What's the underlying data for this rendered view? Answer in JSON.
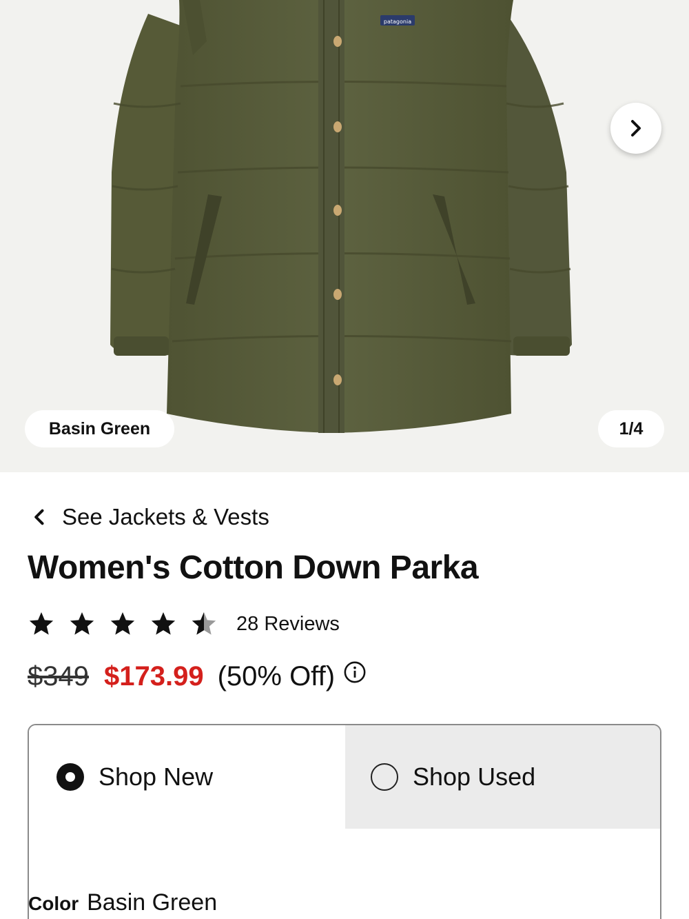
{
  "gallery": {
    "color_badge": "Basin Green",
    "counter": "1/4",
    "next_icon": "chevron-right-icon",
    "brand_tag": "patagonia",
    "jacket_color": "#5a5e3a"
  },
  "breadcrumb": {
    "label": "See Jackets & Vests",
    "icon": "chevron-left-icon"
  },
  "product": {
    "title": "Women's Cotton Down Parka",
    "rating": 4.5,
    "rating_max": 5,
    "reviews_label": "28 Reviews",
    "original_price": "$349",
    "sale_price": "$173.99",
    "discount": "(50% Off)",
    "sale_color": "#d4201c"
  },
  "shop_toggle": {
    "options": [
      {
        "label": "Shop New",
        "selected": true
      },
      {
        "label": "Shop Used",
        "selected": false
      }
    ]
  },
  "color_selector": {
    "key": "Color",
    "value": "Basin Green"
  }
}
